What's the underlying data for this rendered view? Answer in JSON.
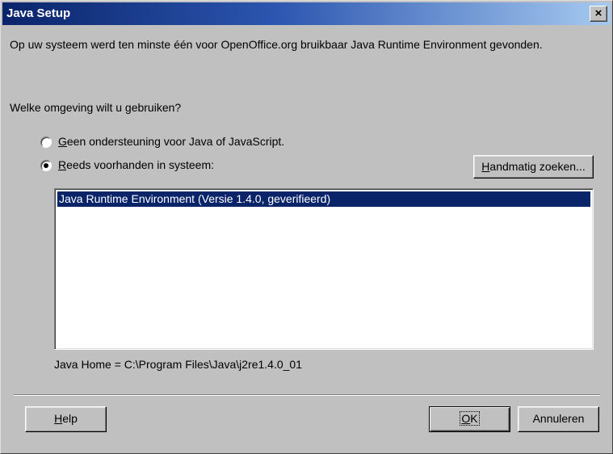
{
  "window": {
    "title": "Java Setup",
    "close_label": "×"
  },
  "intro_text": "Op uw systeem werd ten minste één voor OpenOffice.org bruikbaar Java Runtime Environment gevonden.",
  "question_text": "Welke omgeving wilt u gebruiken?",
  "options": [
    {
      "mnemonic": "G",
      "rest": "een ondersteuning voor Java of JavaScript.",
      "selected": false
    },
    {
      "mnemonic": "R",
      "rest": "eeds voorhanden in systeem:",
      "selected": true
    }
  ],
  "search_button": {
    "mnemonic": "H",
    "rest": "andmatig zoeken..."
  },
  "jre_list": {
    "items": [
      {
        "label": "Java Runtime Environment (Versie 1.4.0, geverifieerd)",
        "selected": true
      }
    ]
  },
  "java_home_text": "Java Home = C:\\Program Files\\Java\\j2re1.4.0_01",
  "footer": {
    "help": {
      "mnemonic": "H",
      "rest": "elp"
    },
    "ok": {
      "mnemonic": "O",
      "rest": "K"
    },
    "cancel": "Annuleren"
  },
  "colors": {
    "title_start": "#0a246a",
    "title_end": "#a6caf0",
    "face": "#c0c0c0",
    "selection": "#0a246a"
  }
}
